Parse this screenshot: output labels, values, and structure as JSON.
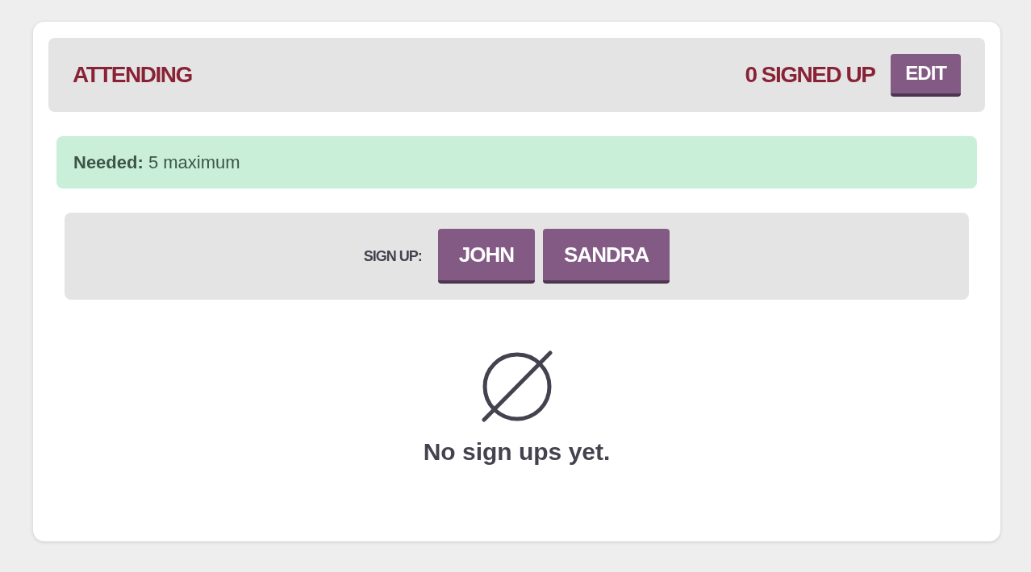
{
  "header": {
    "title": "ATTENDING",
    "count": "0 SIGNED UP",
    "edit_button": "EDIT"
  },
  "notice": {
    "text": "**Needed:** 5 maximum"
  },
  "signup": {
    "label": "SIGN UP:",
    "buttons": [
      "JOHN",
      "SANDRA"
    ]
  },
  "empty_state": {
    "message": "No sign ups yet."
  }
}
